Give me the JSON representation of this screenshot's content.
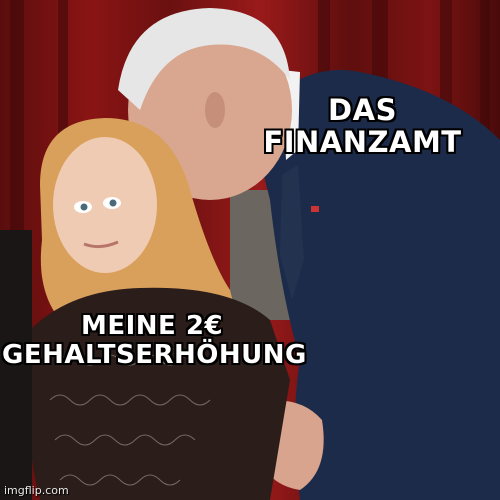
{
  "meme": {
    "top_caption": [
      "DAS",
      "FINANZAMT"
    ],
    "bottom_caption": [
      "MEINE 2€",
      "GEHALTSERHÖHUNG"
    ],
    "watermark": "imgflip.com"
  },
  "colors": {
    "curtain": "#7d1313",
    "suit": "#1c2b4a",
    "hair_girl": "#d9a05b",
    "hair_man": "#e6e6e6",
    "dress": "#2a1d1a",
    "caption_text": "#ffffff",
    "caption_outline": "#000000"
  }
}
